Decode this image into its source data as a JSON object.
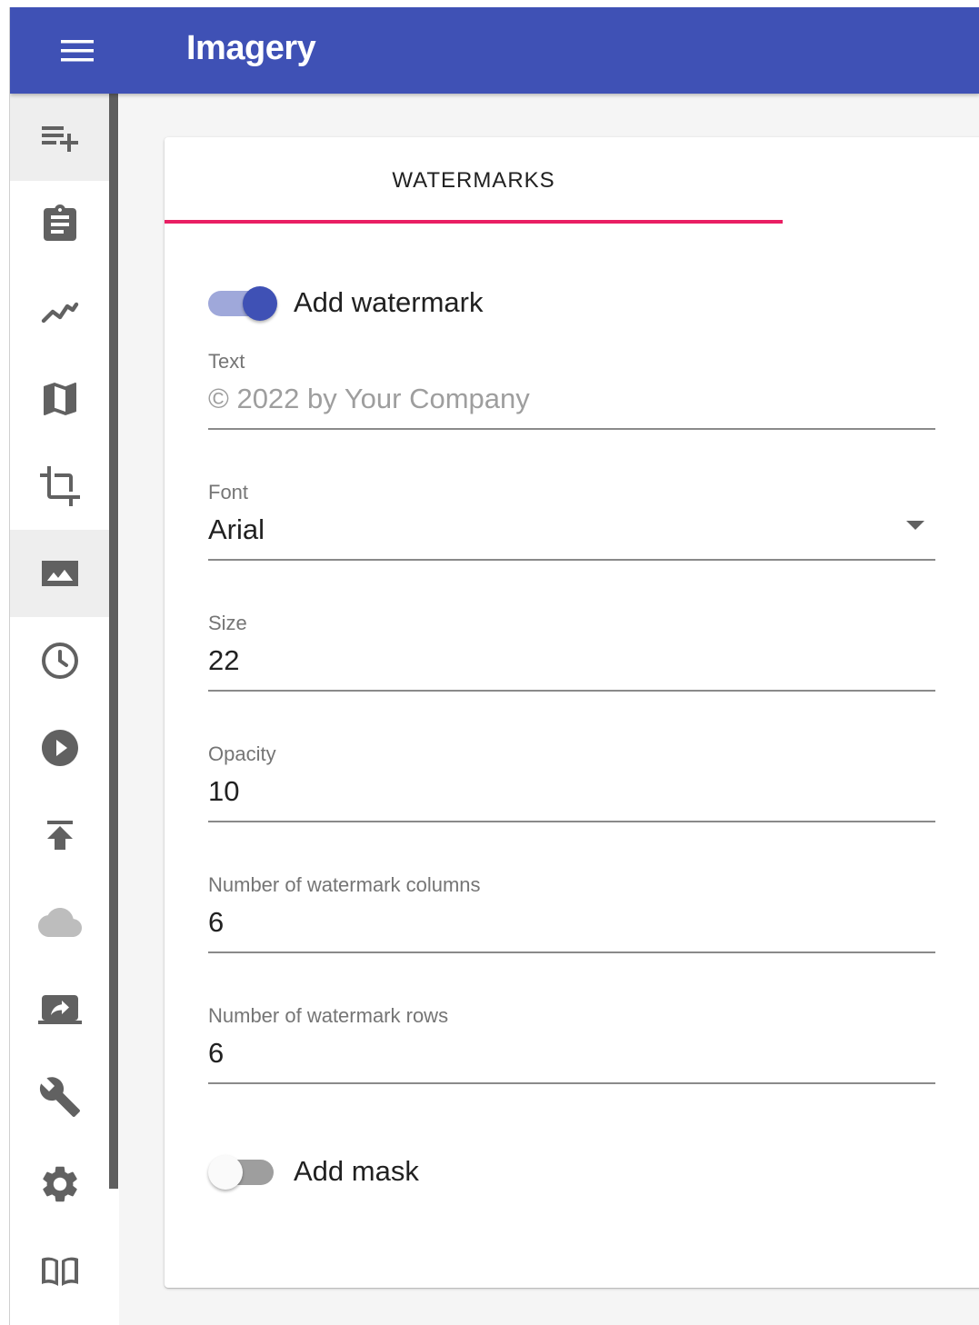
{
  "app": {
    "title": "Imagery"
  },
  "sidebar": {
    "items": [
      {
        "icon": "playlist-add-icon",
        "key": "queue"
      },
      {
        "icon": "clipboard-icon",
        "key": "assignment"
      },
      {
        "icon": "trend-line-icon",
        "key": "trends"
      },
      {
        "icon": "map-icon",
        "key": "map"
      },
      {
        "icon": "crop-icon",
        "key": "crop"
      },
      {
        "icon": "image-icon",
        "key": "image",
        "active": true
      },
      {
        "icon": "clock-icon",
        "key": "schedule"
      },
      {
        "icon": "play-circle-icon",
        "key": "play"
      },
      {
        "icon": "upload-icon",
        "key": "publish"
      },
      {
        "icon": "cloud-icon",
        "key": "cloud",
        "disabled": true
      },
      {
        "icon": "screen-share-icon",
        "key": "share"
      },
      {
        "icon": "wrench-icon",
        "key": "tools"
      },
      {
        "icon": "gear-icon",
        "key": "settings"
      },
      {
        "icon": "book-icon",
        "key": "docs"
      }
    ]
  },
  "tabs": [
    {
      "label": "WATERMARKS",
      "active": true
    }
  ],
  "form": {
    "add_watermark": {
      "label": "Add watermark",
      "checked": true
    },
    "text": {
      "label": "Text",
      "value": "",
      "placeholder": "© 2022 by Your Company"
    },
    "font": {
      "label": "Font",
      "value": "Arial"
    },
    "size": {
      "label": "Size",
      "value": "22"
    },
    "opacity": {
      "label": "Opacity",
      "value": "10"
    },
    "columns": {
      "label": "Number of watermark columns",
      "value": "6"
    },
    "rows": {
      "label": "Number of watermark rows",
      "value": "6"
    },
    "add_mask": {
      "label": "Add mask",
      "checked": false
    }
  },
  "colors": {
    "primary": "#3f51b5",
    "accent": "#e91e63",
    "icon": "#616161"
  }
}
